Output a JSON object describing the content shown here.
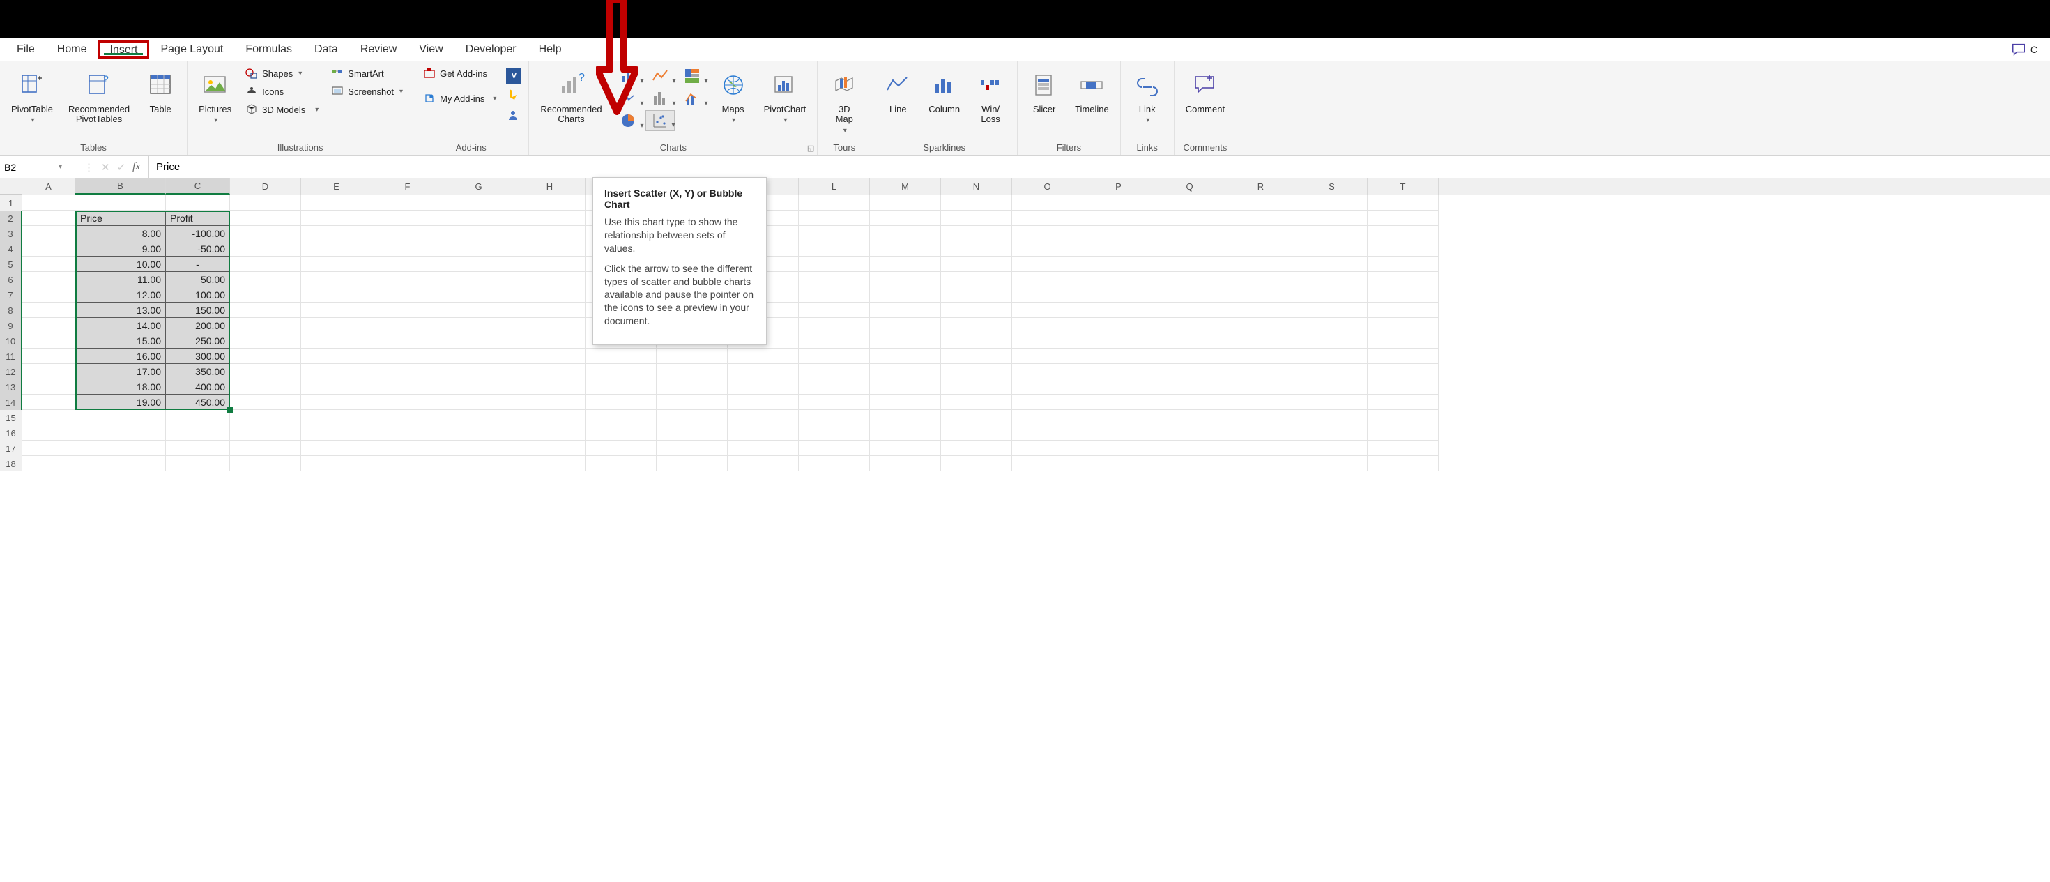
{
  "tabs": [
    "File",
    "Home",
    "Insert",
    "Page Layout",
    "Formulas",
    "Data",
    "Review",
    "View",
    "Developer",
    "Help"
  ],
  "active_tab_index": 2,
  "top_comments_label": "C",
  "ribbon": {
    "tables": {
      "label": "Tables",
      "pivottable": "PivotTable",
      "recommended": "Recommended\nPivotTables",
      "table": "Table"
    },
    "illustrations": {
      "label": "Illustrations",
      "pictures": "Pictures",
      "shapes": "Shapes",
      "icons": "Icons",
      "models": "3D Models",
      "smartart": "SmartArt",
      "screenshot": "Screenshot"
    },
    "addins": {
      "label": "Add-ins",
      "get": "Get Add-ins",
      "my": "My Add-ins"
    },
    "charts": {
      "label": "Charts",
      "recommended": "Recommended\nCharts",
      "maps": "Maps",
      "pivotchart": "PivotChart"
    },
    "tours": {
      "label": "Tours",
      "map3d": "3D\nMap"
    },
    "sparklines": {
      "label": "Sparklines",
      "line": "Line",
      "column": "Column",
      "winloss": "Win/\nLoss"
    },
    "filters": {
      "label": "Filters",
      "slicer": "Slicer",
      "timeline": "Timeline"
    },
    "links": {
      "label": "Links",
      "link": "Link"
    },
    "comments": {
      "label": "Comments",
      "comment": "Comment"
    }
  },
  "tooltip": {
    "title": "Insert Scatter (X, Y) or Bubble Chart",
    "p1": "Use this chart type to show the relationship between sets of values.",
    "p2": "Click the arrow to see the different types of scatter and bubble charts available and pause the pointer on the icons to see a preview in your document."
  },
  "namebox": "B2",
  "formula": "Price",
  "columns": [
    "A",
    "B",
    "C",
    "D",
    "E",
    "F",
    "G",
    "H",
    "I",
    "J",
    "K",
    "L",
    "M",
    "N",
    "O",
    "P",
    "Q",
    "R",
    "S",
    "T"
  ],
  "row_count": 18,
  "data_headers": [
    "Price",
    "Profit"
  ],
  "data_rows": [
    [
      "8.00",
      "-100.00"
    ],
    [
      "9.00",
      "-50.00"
    ],
    [
      "10.00",
      "-"
    ],
    [
      "11.00",
      "50.00"
    ],
    [
      "12.00",
      "100.00"
    ],
    [
      "13.00",
      "150.00"
    ],
    [
      "14.00",
      "200.00"
    ],
    [
      "15.00",
      "250.00"
    ],
    [
      "16.00",
      "300.00"
    ],
    [
      "17.00",
      "350.00"
    ],
    [
      "18.00",
      "400.00"
    ],
    [
      "19.00",
      "450.00"
    ]
  ],
  "chart_data": {
    "type": "table",
    "title": "",
    "columns": [
      "Price",
      "Profit"
    ],
    "rows": [
      [
        8.0,
        -100.0
      ],
      [
        9.0,
        -50.0
      ],
      [
        10.0,
        0.0
      ],
      [
        11.0,
        50.0
      ],
      [
        12.0,
        100.0
      ],
      [
        13.0,
        150.0
      ],
      [
        14.0,
        200.0
      ],
      [
        15.0,
        250.0
      ],
      [
        16.0,
        300.0
      ],
      [
        17.0,
        350.0
      ],
      [
        18.0,
        400.0
      ],
      [
        19.0,
        450.0
      ]
    ]
  }
}
